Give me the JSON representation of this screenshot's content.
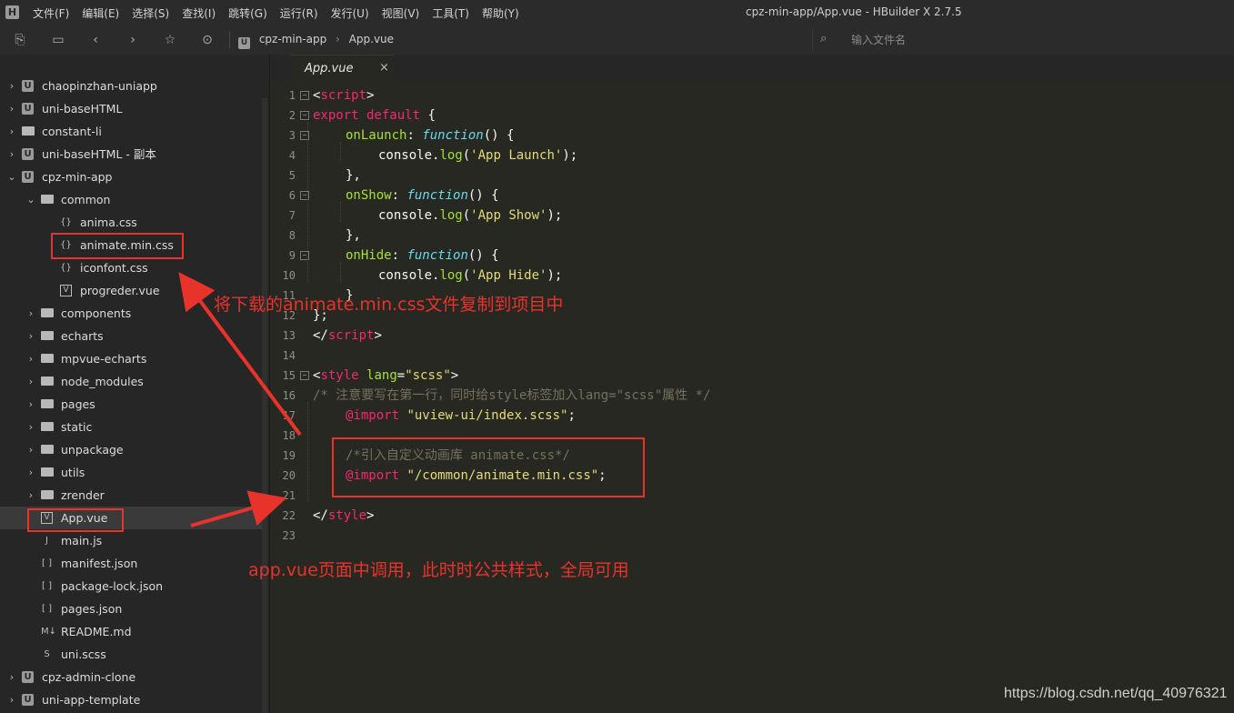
{
  "app": {
    "logo": "H",
    "title": "cpz-min-app/App.vue - HBuilder X 2.7.5",
    "menu": [
      "文件(F)",
      "编辑(E)",
      "选择(S)",
      "查找(I)",
      "跳转(G)",
      "运行(R)",
      "发行(U)",
      "视图(V)",
      "工具(T)",
      "帮助(Y)"
    ]
  },
  "toolbar": {
    "breadcrumb": [
      "cpz-min-app",
      "App.vue"
    ],
    "search_placeholder": "输入文件名"
  },
  "sidebar": {
    "items": [
      {
        "label": "chaopinzhan-uniapp",
        "icon": "project-icon",
        "chevron": "›"
      },
      {
        "label": "uni-baseHTML",
        "icon": "project-icon",
        "chevron": "›"
      },
      {
        "label": "constant-li",
        "icon": "folder-icon",
        "chevron": "›"
      },
      {
        "label": "uni-baseHTML - 副本",
        "icon": "project-icon",
        "chevron": "›"
      },
      {
        "label": "cpz-min-app",
        "icon": "project-icon",
        "chevron": "⌄"
      },
      {
        "label": "common",
        "icon": "folder-icon",
        "chevron": "⌄"
      },
      {
        "label": "anima.css",
        "icon": "css-icon",
        "chevron": ""
      },
      {
        "label": "animate.min.css",
        "icon": "css-icon",
        "chevron": ""
      },
      {
        "label": "iconfont.css",
        "icon": "css-icon",
        "chevron": ""
      },
      {
        "label": "progreder.vue",
        "icon": "vue-file-icon",
        "chevron": ""
      },
      {
        "label": "components",
        "icon": "folder-icon",
        "chevron": "›"
      },
      {
        "label": "echarts",
        "icon": "folder-icon",
        "chevron": "›"
      },
      {
        "label": "mpvue-echarts",
        "icon": "folder-icon",
        "chevron": "›"
      },
      {
        "label": "node_modules",
        "icon": "folder-icon",
        "chevron": "›"
      },
      {
        "label": "pages",
        "icon": "folder-icon",
        "chevron": "›"
      },
      {
        "label": "static",
        "icon": "folder-icon",
        "chevron": "›"
      },
      {
        "label": "unpackage",
        "icon": "folder-icon",
        "chevron": "›"
      },
      {
        "label": "utils",
        "icon": "folder-icon",
        "chevron": "›"
      },
      {
        "label": "zrender",
        "icon": "folder-icon",
        "chevron": "›"
      },
      {
        "label": "App.vue",
        "icon": "vue-file-icon",
        "chevron": ""
      },
      {
        "label": "main.js",
        "icon": "js-file-icon",
        "chevron": ""
      },
      {
        "label": "manifest.json",
        "icon": "json-icon",
        "chevron": ""
      },
      {
        "label": "package-lock.json",
        "icon": "json-icon",
        "chevron": ""
      },
      {
        "label": "pages.json",
        "icon": "json-icon",
        "chevron": ""
      },
      {
        "label": "README.md",
        "icon": "markdown-icon",
        "chevron": ""
      },
      {
        "label": "uni.scss",
        "icon": "scss-icon",
        "chevron": ""
      },
      {
        "label": "cpz-admin-clone",
        "icon": "project-icon",
        "chevron": "›"
      },
      {
        "label": "uni-app-template",
        "icon": "project-icon",
        "chevron": "›"
      }
    ]
  },
  "editor": {
    "tab_label": "App.vue",
    "lines": [
      {
        "n": "1",
        "fold": true
      },
      {
        "n": "2",
        "fold": true
      },
      {
        "n": "3",
        "fold": true
      },
      {
        "n": "4",
        "fold": false
      },
      {
        "n": "5",
        "fold": false
      },
      {
        "n": "6",
        "fold": true
      },
      {
        "n": "7",
        "fold": false
      },
      {
        "n": "8",
        "fold": false
      },
      {
        "n": "9",
        "fold": true
      },
      {
        "n": "10",
        "fold": false
      },
      {
        "n": "11",
        "fold": false
      },
      {
        "n": "12",
        "fold": false
      },
      {
        "n": "13",
        "fold": false
      },
      {
        "n": "14",
        "fold": false
      },
      {
        "n": "15",
        "fold": true
      },
      {
        "n": "16",
        "fold": false
      },
      {
        "n": "17",
        "fold": false
      },
      {
        "n": "18",
        "fold": false
      },
      {
        "n": "19",
        "fold": false
      },
      {
        "n": "20",
        "fold": false
      },
      {
        "n": "21",
        "fold": false
      },
      {
        "n": "22",
        "fold": false
      },
      {
        "n": "23",
        "fold": false
      }
    ],
    "code": {
      "l1_tag_open": "<",
      "l1_tag": "script",
      "l1_tag_close": ">",
      "l2_kw": "export default",
      "l2_rest": " {",
      "l3_fn": "onLaunch",
      "l3_colon": ": ",
      "l3_fnkw": "function",
      "l3_rest": "() {",
      "l4_a": "console.",
      "l4_b": "log",
      "l4_c": "(",
      "l4_str": "'App Launch'",
      "l4_d": ");",
      "l5": "},",
      "l6_fn": "onShow",
      "l6_colon": ": ",
      "l6_fnkw": "function",
      "l6_rest": "() {",
      "l7_a": "console.",
      "l7_b": "log",
      "l7_c": "(",
      "l7_str": "'App Show'",
      "l7_d": ");",
      "l8": "},",
      "l9_fn": "onHide",
      "l9_colon": ": ",
      "l9_fnkw": "function",
      "l9_rest": "() {",
      "l10_a": "console.",
      "l10_b": "log",
      "l10_c": "(",
      "l10_str": "'App Hide'",
      "l10_d": ");",
      "l11": "}",
      "l12": "};",
      "l13_a": "</",
      "l13_tag": "script",
      "l13_b": ">",
      "l15_a": "<",
      "l15_tag": "style",
      "l15_sp": " ",
      "l15_attr": "lang",
      "l15_eq": "=",
      "l15_str": "\"scss\"",
      "l15_b": ">",
      "l16": "/* 注意要写在第一行，同时给style标签加入lang=\"scss\"属性 */",
      "l17_at": "@import",
      "l17_sp": " ",
      "l17_str": "\"uview-ui/index.scss\"",
      "l17_end": ";",
      "l19": "/*引入自定义动画库 animate.css*/",
      "l20_at": "@import",
      "l20_sp": " ",
      "l20_str": "\"/common/animate.min.css\"",
      "l20_end": ";",
      "l22_a": "</",
      "l22_tag": "style",
      "l22_b": ">"
    }
  },
  "annotations": {
    "copy_note": "将下载的animate.min.css文件复制到项目中",
    "use_note": "app.vue页面中调用，此时时公共样式，全局可用"
  },
  "watermark": "https://blog.csdn.net/qq_40976321",
  "colors": {
    "highlight": "#e8332b",
    "editor_bg": "#272822",
    "sidebar_bg": "#262626"
  }
}
